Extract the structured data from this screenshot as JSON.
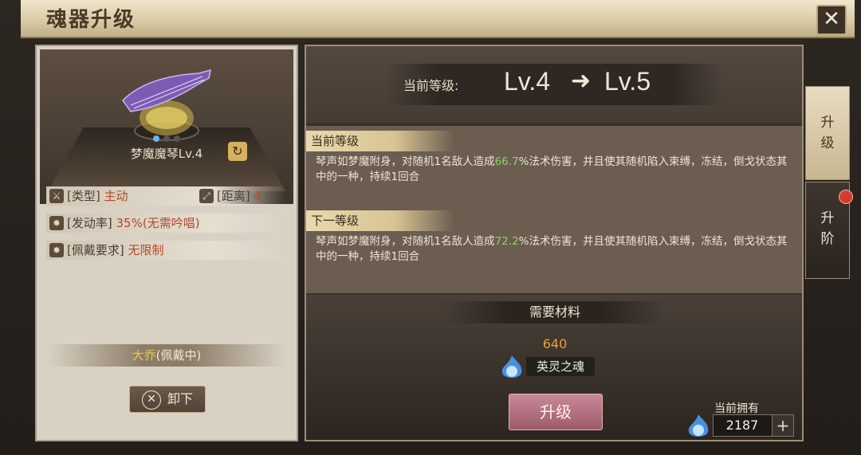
{
  "window": {
    "title": "魂器升级"
  },
  "weapon": {
    "name": "梦魔魔琴Lv.4"
  },
  "attributes": {
    "type_label": "[类型]",
    "type_value": "主动",
    "distance_label": "[距离]",
    "distance_value": "4",
    "trigger_label": "[发动率]",
    "trigger_value": "35%(无需吟唱)",
    "require_label": "[佩戴要求]",
    "require_value": "无限制"
  },
  "owner": {
    "name": "大乔",
    "status": "(佩戴中)"
  },
  "buttons": {
    "unequip": "卸下",
    "upgrade": "升级"
  },
  "level": {
    "label": "当前等级:",
    "current": "Lv.4",
    "arrow": "➜",
    "next": "Lv.5"
  },
  "current_level": {
    "title": "当前等级",
    "text_a": "琴声如梦魔附身，对随机1名敌人造成",
    "value": "66.7",
    "text_b": "%法术伤害，并且使其随机陷入束缚，冻结，倒戈状态其中的一种，持续1回合"
  },
  "next_level": {
    "title": "下一等级",
    "text_a": "琴声如梦魔附身，对随机1名敌人造成",
    "value": "72.2",
    "text_b": "%法术伤害，并且使其随机陷入束缚，冻结，倒戈状态其中的一种，持续1回合"
  },
  "materials": {
    "title": "需要材料",
    "count": "640",
    "item_name": "英灵之魂",
    "owned_label": "当前拥有",
    "owned_value": "2187"
  },
  "tabs": {
    "upgrade": "升级",
    "advance": "升阶"
  },
  "colors": {
    "highlight_green": "#8fd26e",
    "count_orange": "#e7a33b",
    "owner_gold": "#f0c54a",
    "value_red": "#b24a2a"
  }
}
